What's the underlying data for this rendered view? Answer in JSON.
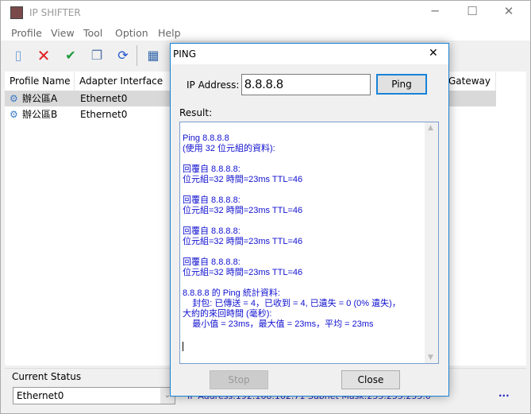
{
  "window": {
    "title": "IP SHIFTER",
    "minimize": "─",
    "maximize": "☐",
    "close": "✕"
  },
  "menu": [
    "Profile",
    "View",
    "Tool",
    "Option",
    "Help"
  ],
  "toolbar": {
    "icons": [
      "new-profile-icon",
      "delete-icon",
      "apply-icon",
      "copy-icon",
      "refresh-icon",
      "view-icon"
    ]
  },
  "list": {
    "columns": [
      "Profile Name",
      "Adapter Interface",
      "Gateway"
    ],
    "rows": [
      {
        "name": "辦公區A",
        "adapter": "Ethernet0"
      },
      {
        "name": "辦公區B",
        "adapter": "Ethernet0"
      }
    ]
  },
  "status": {
    "label": "Current Status",
    "adapter": "Ethernet0",
    "info": "IP Address:192.168.162.71   Subnet Mask:255.255.255.0",
    "more": "..."
  },
  "dialog": {
    "title": "PING",
    "close": "✕",
    "ip_label": "IP Address:",
    "ip_value": "8.8.8.8",
    "ping": "Ping",
    "result_label": "Result:",
    "result_text": "Ping 8.8.8.8\n(使用 32 位元組的資料):\n\n回覆自 8.8.8.8:\n位元組=32 時間=23ms TTL=46\n\n回覆自 8.8.8.8:\n位元組=32 時間=23ms TTL=46\n\n回覆自 8.8.8.8:\n位元組=32 時間=23ms TTL=46\n\n回覆自 8.8.8.8:\n位元組=32 時間=23ms TTL=46\n\n8.8.8.8 的 Ping 統計資料:\n    封包: 已傳送 = 4，已收到 = 4, 已遺失 = 0 (0% 遺失)，\n大約的來回時間 (毫秒):\n    最小值 = 23ms，最大值 = 23ms，平均 = 23ms",
    "stop": "Stop",
    "close_btn": "Close"
  },
  "colors": {
    "accent": "#1883d7",
    "result_text": "#1010d0",
    "selected_row": "#d9d9d9"
  }
}
